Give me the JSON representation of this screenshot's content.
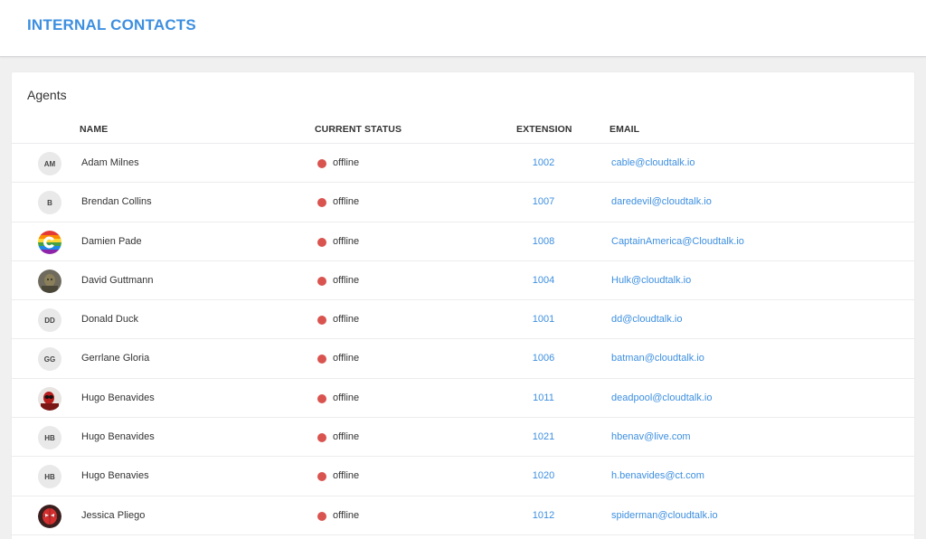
{
  "header": {
    "title": "INTERNAL CONTACTS"
  },
  "agents_card": {
    "title": "Agents",
    "columns": {
      "name": "NAME",
      "status": "CURRENT STATUS",
      "extension": "EXTENSION",
      "email": "EMAIL"
    },
    "rows": [
      {
        "initials": "AM",
        "avatar": "initials",
        "name": "Adam Milnes",
        "status": "offline",
        "extension": "1002",
        "email": "cable@cloudtalk.io"
      },
      {
        "initials": "B",
        "avatar": "initials",
        "name": "Brendan Collins",
        "status": "offline",
        "extension": "1007",
        "email": "daredevil@cloudtalk.io"
      },
      {
        "initials": "",
        "avatar": "rainbow-logo",
        "name": "Damien Pade",
        "status": "offline",
        "extension": "1008",
        "email": "CaptainAmerica@Cloudtalk.io"
      },
      {
        "initials": "",
        "avatar": "photo-hulk",
        "name": "David Guttmann",
        "status": "offline",
        "extension": "1004",
        "email": "Hulk@cloudtalk.io"
      },
      {
        "initials": "DD",
        "avatar": "initials",
        "name": "Donald Duck",
        "status": "offline",
        "extension": "1001",
        "email": "dd@cloudtalk.io"
      },
      {
        "initials": "GG",
        "avatar": "initials",
        "name": "Gerrlane Gloria",
        "status": "offline",
        "extension": "1006",
        "email": "batman@cloudtalk.io"
      },
      {
        "initials": "",
        "avatar": "photo-deadpool",
        "name": "Hugo Benavides",
        "status": "offline",
        "extension": "1011",
        "email": "deadpool@cloudtalk.io"
      },
      {
        "initials": "HB",
        "avatar": "initials",
        "name": "Hugo Benavides",
        "status": "offline",
        "extension": "1021",
        "email": "hbenav@live.com"
      },
      {
        "initials": "HB",
        "avatar": "initials",
        "name": "Hugo Benavies",
        "status": "offline",
        "extension": "1020",
        "email": "h.benavides@ct.com"
      },
      {
        "initials": "",
        "avatar": "photo-spiderman",
        "name": "Jessica Pliego",
        "status": "offline",
        "extension": "1012",
        "email": "spiderman@cloudtalk.io"
      }
    ]
  },
  "colors": {
    "accent": "#3d8fe0",
    "offline": "#d9534f"
  }
}
